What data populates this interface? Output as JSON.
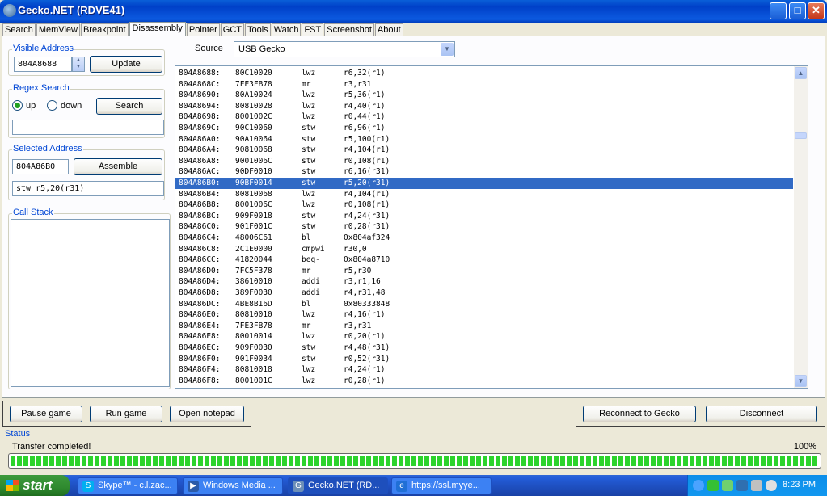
{
  "window": {
    "title": "Gecko.NET (RDVE41)"
  },
  "tabs": [
    "Search",
    "MemView",
    "Breakpoint",
    "Disassembly",
    "Pointer",
    "GCT",
    "Tools",
    "Watch",
    "FST",
    "Screenshot",
    "About"
  ],
  "active_tab": "Disassembly",
  "visible_address": {
    "legend": "Visible Address",
    "value": "804A8688",
    "update_label": "Update"
  },
  "regex": {
    "legend": "Regex Search",
    "up_label": "up",
    "down_label": "down",
    "search_label": "Search",
    "query": ""
  },
  "selected_address": {
    "legend": "Selected Address",
    "value": "804A86B0",
    "assemble_label": "Assemble",
    "instruction": "stw r5,20(r31)"
  },
  "call_stack": {
    "legend": "Call Stack"
  },
  "source": {
    "label": "Source",
    "value": "USB Gecko"
  },
  "disassembly": [
    {
      "addr": "804A8688:",
      "hex": "80C10020",
      "op": "lwz",
      "args": "r6,32(r1)"
    },
    {
      "addr": "804A868C:",
      "hex": "7FE3FB78",
      "op": "mr",
      "args": "r3,r31"
    },
    {
      "addr": "804A8690:",
      "hex": "80A10024",
      "op": "lwz",
      "args": "r5,36(r1)"
    },
    {
      "addr": "804A8694:",
      "hex": "80810028",
      "op": "lwz",
      "args": "r4,40(r1)"
    },
    {
      "addr": "804A8698:",
      "hex": "8001002C",
      "op": "lwz",
      "args": "r0,44(r1)"
    },
    {
      "addr": "804A869C:",
      "hex": "90C10060",
      "op": "stw",
      "args": "r6,96(r1)"
    },
    {
      "addr": "804A86A0:",
      "hex": "90A10064",
      "op": "stw",
      "args": "r5,100(r1)"
    },
    {
      "addr": "804A86A4:",
      "hex": "90810068",
      "op": "stw",
      "args": "r4,104(r1)"
    },
    {
      "addr": "804A86A8:",
      "hex": "9001006C",
      "op": "stw",
      "args": "r0,108(r1)"
    },
    {
      "addr": "804A86AC:",
      "hex": "90DF0010",
      "op": "stw",
      "args": "r6,16(r31)"
    },
    {
      "addr": "804A86B0:",
      "hex": "90BF0014",
      "op": "stw",
      "args": "r5,20(r31)"
    },
    {
      "addr": "804A86B4:",
      "hex": "80810068",
      "op": "lwz",
      "args": "r4,104(r1)"
    },
    {
      "addr": "804A86B8:",
      "hex": "8001006C",
      "op": "lwz",
      "args": "r0,108(r1)"
    },
    {
      "addr": "804A86BC:",
      "hex": "909F0018",
      "op": "stw",
      "args": "r4,24(r31)"
    },
    {
      "addr": "804A86C0:",
      "hex": "901F001C",
      "op": "stw",
      "args": "r0,28(r31)"
    },
    {
      "addr": "804A86C4:",
      "hex": "48006C61",
      "op": "bl",
      "args": "0x804af324"
    },
    {
      "addr": "804A86C8:",
      "hex": "2C1E0000",
      "op": "cmpwi",
      "args": "r30,0"
    },
    {
      "addr": "804A86CC:",
      "hex": "41820044",
      "op": "beq-",
      "args": "0x804a8710"
    },
    {
      "addr": "804A86D0:",
      "hex": "7FC5F378",
      "op": "mr",
      "args": "r5,r30"
    },
    {
      "addr": "804A86D4:",
      "hex": "38610010",
      "op": "addi",
      "args": "r3,r1,16"
    },
    {
      "addr": "804A86D8:",
      "hex": "389F0030",
      "op": "addi",
      "args": "r4,r31,48"
    },
    {
      "addr": "804A86DC:",
      "hex": "4BE8B16D",
      "op": "bl",
      "args": "0x80333848"
    },
    {
      "addr": "804A86E0:",
      "hex": "80810010",
      "op": "lwz",
      "args": "r4,16(r1)"
    },
    {
      "addr": "804A86E4:",
      "hex": "7FE3FB78",
      "op": "mr",
      "args": "r3,r31"
    },
    {
      "addr": "804A86E8:",
      "hex": "80010014",
      "op": "lwz",
      "args": "r0,20(r1)"
    },
    {
      "addr": "804A86EC:",
      "hex": "909F0030",
      "op": "stw",
      "args": "r4,48(r31)"
    },
    {
      "addr": "804A86F0:",
      "hex": "901F0034",
      "op": "stw",
      "args": "r0,52(r31)"
    },
    {
      "addr": "804A86F4:",
      "hex": "80810018",
      "op": "lwz",
      "args": "r4,24(r1)"
    },
    {
      "addr": "804A86F8:",
      "hex": "8001001C",
      "op": "lwz",
      "args": "r0,28(r1)"
    }
  ],
  "selected_row": 10,
  "buttons": {
    "pause": "Pause game",
    "run": "Run game",
    "notepad": "Open notepad",
    "reconnect": "Reconnect to Gecko",
    "disconnect": "Disconnect"
  },
  "status": {
    "label": "Status",
    "text": "Transfer completed!",
    "percent_text": "100%",
    "progress": 1.0
  },
  "taskbar": {
    "start": "start",
    "items": [
      {
        "label": "Skype™ - c.l.zac...",
        "icon": "S",
        "color": "#00aff0"
      },
      {
        "label": "Windows Media ...",
        "icon": "▶",
        "color": "#2b5aa8"
      },
      {
        "label": "Gecko.NET (RD...",
        "icon": "G",
        "color": "#6c8fb8"
      },
      {
        "label": "https://ssl.myye...",
        "icon": "e",
        "color": "#1f6fd6"
      }
    ],
    "clock": "8:23 PM"
  }
}
